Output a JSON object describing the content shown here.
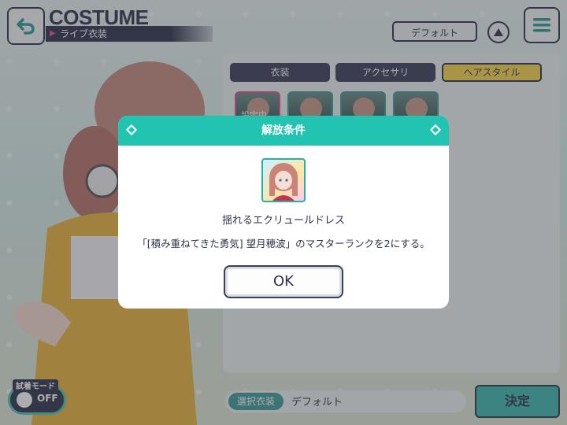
{
  "header": {
    "title": "COSTUME",
    "subtitle": "ライブ衣装",
    "preset_label": "デフォルト",
    "back_icon": "back-arrow-icon",
    "menu_icon": "hamburger-menu-icon",
    "up_icon": "triangle-up-icon"
  },
  "tabs": [
    {
      "label": "衣装",
      "active": false
    },
    {
      "label": "アクセサリ",
      "active": false
    },
    {
      "label": "ヘアスタイル",
      "active": true
    }
  ],
  "thumbnails": [
    {
      "label": "設定中",
      "selected": true
    },
    {
      "label": "",
      "selected": false
    },
    {
      "label": "",
      "selected": false
    },
    {
      "label": "",
      "selected": false
    }
  ],
  "modal": {
    "title": "解放条件",
    "item_name": "揺れるエクリュールドレス",
    "condition": "「[積み重ねてきた勇気] 望月穂波」のマスターランクを2にする。",
    "ok_label": "OK"
  },
  "footer": {
    "trial_label": "試着モード",
    "trial_state": "OFF",
    "selected_tag": "選択衣装",
    "selected_value": "デフォルト",
    "decide_label": "決定"
  },
  "colors": {
    "navy": "#2d3248",
    "teal": "#22c3b0",
    "yellow_tab": "#f6d64a",
    "pink_accent": "#e6508c"
  }
}
